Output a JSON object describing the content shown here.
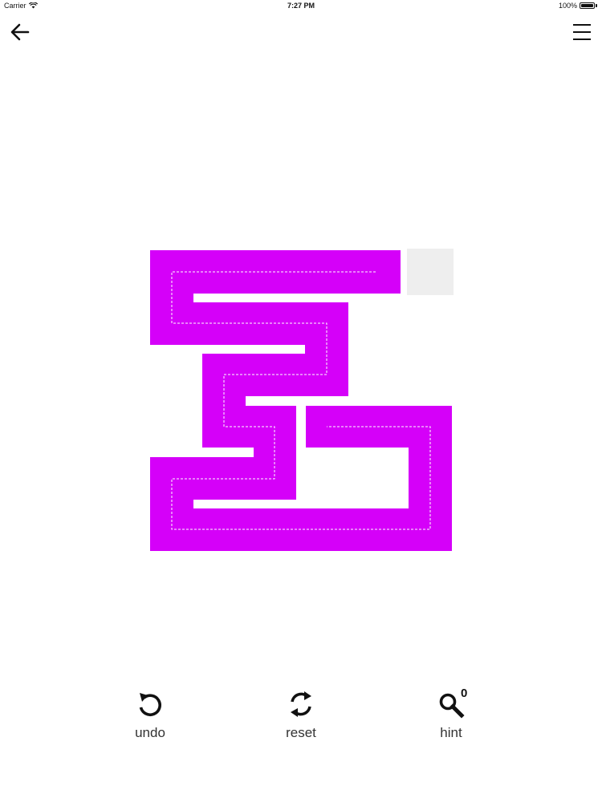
{
  "status_bar": {
    "carrier": "Carrier",
    "time": "7:27 PM",
    "battery": "100%",
    "battery_level": 1.0
  },
  "nav": {
    "back_icon": "arrow-left-icon",
    "menu_icon": "hamburger-menu-icon"
  },
  "board": {
    "path_color": "#d500f9",
    "empty_cell_color": "#eeeeee",
    "guide_color": "#ffffff"
  },
  "toolbar": {
    "undo_label": "undo",
    "reset_label": "reset",
    "hint_label": "hint",
    "hint_count": "0",
    "undo_icon": "undo-arrow-icon",
    "reset_icon": "refresh-icon",
    "hint_icon": "magnifier-icon"
  }
}
